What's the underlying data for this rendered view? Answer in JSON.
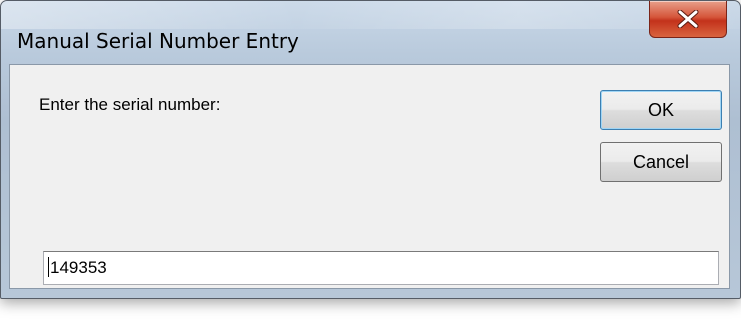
{
  "window": {
    "title": "Manual Serial Number Entry",
    "close_icon": "close-icon"
  },
  "form": {
    "prompt": "Enter the serial number:",
    "serial_value": "149353"
  },
  "buttons": {
    "ok_label": "OK",
    "cancel_label": "Cancel"
  },
  "colors": {
    "close_button": "#c3321b",
    "dialog_body": "#f0f0f0",
    "default_button_border": "#3c7fb1"
  }
}
